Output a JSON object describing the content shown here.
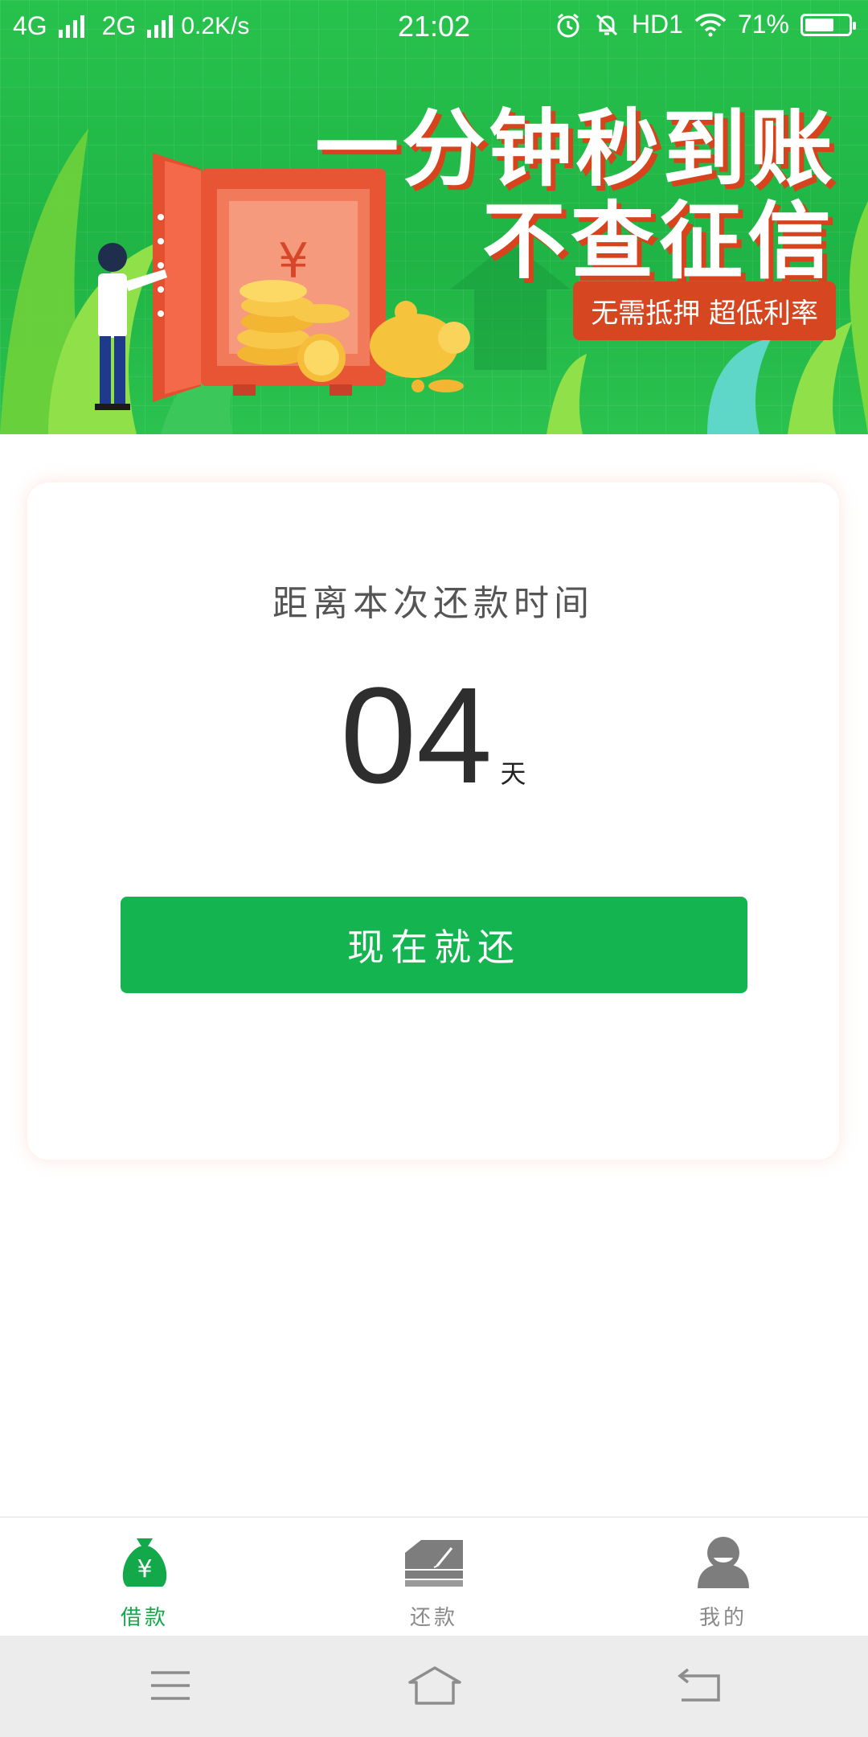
{
  "status_bar": {
    "network_left": "4G",
    "network_right": "2G",
    "speed": "0.2K/s",
    "time": "21:02",
    "hd_label": "HD1",
    "battery_percent": "71%",
    "battery_level": 0.71
  },
  "banner": {
    "headline_line1": "一分钟秒到账",
    "headline_line2": "不查征信",
    "tag": "无需抵押 超低利率",
    "currency_symbol": "¥"
  },
  "countdown": {
    "subtitle": "距离本次还款时间",
    "days_value": "04",
    "days_unit": "天",
    "pay_button_label": "现在就还"
  },
  "tabbar": {
    "items": [
      {
        "label": "借款",
        "icon": "money-bag-icon",
        "active": true
      },
      {
        "label": "还款",
        "icon": "repay-card-icon",
        "active": false
      },
      {
        "label": "我的",
        "icon": "user-profile-icon",
        "active": false
      }
    ]
  },
  "colors": {
    "brand_green": "#14b451",
    "tab_active": "#13a84a",
    "tab_inactive": "#8a8a8a",
    "banner_accent": "#d64620"
  },
  "system_nav": {
    "buttons": [
      "menu-icon",
      "home-icon",
      "back-icon"
    ]
  }
}
